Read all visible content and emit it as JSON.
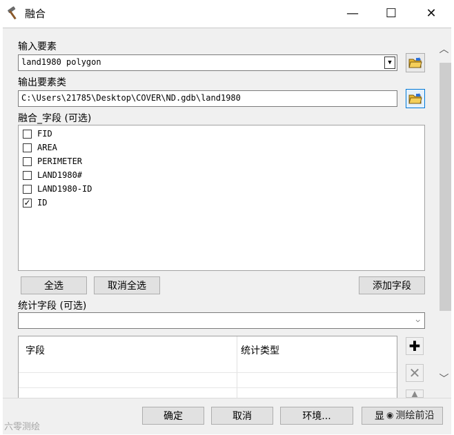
{
  "window": {
    "title": "融合",
    "min_glyph": "—",
    "max_glyph": "☐",
    "close_glyph": "✕"
  },
  "input_features": {
    "label": "输入要素",
    "value": "land1980 polygon"
  },
  "output_features": {
    "label": "输出要素类",
    "value": "C:\\Users\\21785\\Desktop\\COVER\\ND.gdb\\land1980"
  },
  "dissolve_fields": {
    "label": "融合_字段 (可选)",
    "items": [
      {
        "label": "FID",
        "checked": false
      },
      {
        "label": "AREA",
        "checked": false
      },
      {
        "label": "PERIMETER",
        "checked": false
      },
      {
        "label": "LAND1980#",
        "checked": false
      },
      {
        "label": "LAND1980-ID",
        "checked": false
      },
      {
        "label": "ID",
        "checked": true
      }
    ]
  },
  "buttons": {
    "select_all": "全选",
    "unselect_all": "取消全选",
    "add_field": "添加字段"
  },
  "statistics": {
    "label": "统计字段 (可选)",
    "col_field": "字段",
    "col_type": "统计类型"
  },
  "bottom": {
    "ok": "确定",
    "cancel": "取消",
    "env": "环境...",
    "hide_help": "显"
  },
  "watermarks": {
    "left": "六零测绘",
    "right": "测绘前沿"
  },
  "icons": {
    "folder": "folder-open-icon",
    "hammer": "hammer-icon"
  }
}
